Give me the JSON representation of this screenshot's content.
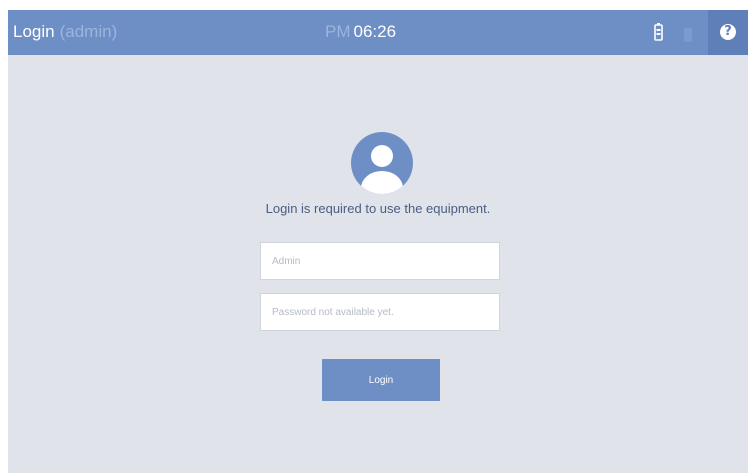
{
  "header": {
    "title": "Login",
    "user": "(admin)",
    "time_period": "PM",
    "time": "06:26",
    "help_label": "?"
  },
  "icons": {
    "battery": "battery-icon",
    "status": "status-icon",
    "help": "help-icon",
    "avatar": "user-avatar-icon"
  },
  "colors": {
    "header_bg": "#6e8fc6",
    "help_bg": "#5e7fb8",
    "page_bg": "#e0e4ea",
    "button_bg": "#6e8fc6",
    "message_text": "#4a5d82"
  },
  "login": {
    "message": "Login is required to use the equipment.",
    "username_placeholder": "Admin",
    "password_placeholder": "Password not available yet.",
    "button_label": "Login"
  }
}
